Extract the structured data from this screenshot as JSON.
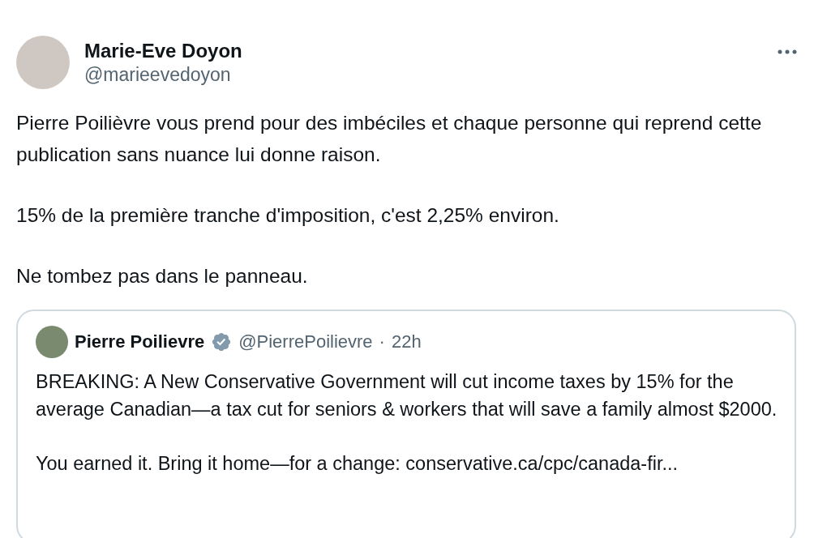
{
  "author": {
    "name": "Marie-Eve Doyon",
    "handle": "@marieevedoyon"
  },
  "paragraphs": [
    "Pierre Poilièvre vous prend pour des imbéciles et chaque personne qui reprend cette publication sans nuance lui donne raison.",
    "15% de la première tranche d'imposition, c'est 2,25% environ.",
    "Ne tombez pas dans le panneau."
  ],
  "quoted": {
    "name": "Pierre Poilievre",
    "verified": true,
    "handle": "@PierrePoilievre",
    "separator": "·",
    "time": "22h",
    "paragraphs": [
      "BREAKING: A New Conservative Government will cut income taxes by 15% for the average Canadian—a tax cut for seniors & workers that will save a family almost $2000.",
      "You earned it. Bring it home—for a change: conservative.ca/cpc/canada-fir..."
    ]
  }
}
